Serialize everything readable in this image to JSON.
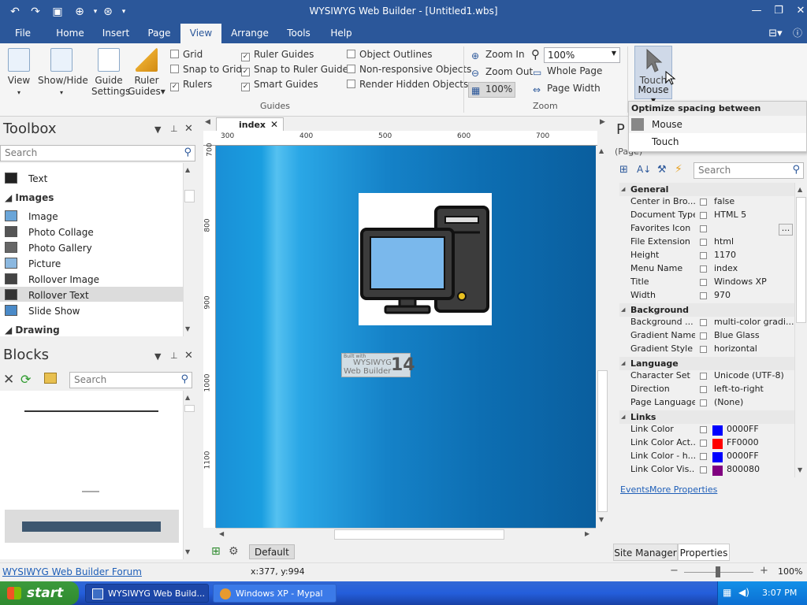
{
  "window": {
    "title": "WYSIWYG Web Builder - [Untitled1.wbs]"
  },
  "menu": {
    "tabs": [
      "File",
      "Home",
      "Insert",
      "Page",
      "View",
      "Arrange",
      "Tools",
      "Help"
    ],
    "active": "View"
  },
  "ribbon": {
    "view_label": "View",
    "showhide_label": "Show/Hide",
    "guide_settings_label": "Guide Settings",
    "ruler_guides_label": "Ruler Guides",
    "guides_checks": [
      {
        "label": "Grid",
        "checked": false
      },
      {
        "label": "Snap to Grid",
        "checked": false
      },
      {
        "label": "Rulers",
        "checked": true
      },
      {
        "label": "Ruler Guides",
        "checked": true
      },
      {
        "label": "Snap to Ruler Guides",
        "checked": true
      },
      {
        "label": "Smart Guides",
        "checked": true
      },
      {
        "label": "Object Outlines",
        "checked": false
      },
      {
        "label": "Non-responsive Objects",
        "checked": false
      },
      {
        "label": "Render Hidden Objects",
        "checked": false
      }
    ],
    "guides_group": "Guides",
    "zoom_in": "Zoom In",
    "zoom_out": "Zoom Out",
    "zoom_100": "100%",
    "zoom_value": "100%",
    "whole_page": "Whole Page",
    "page_width": "Page Width",
    "zoom_group": "Zoom",
    "touch_mouse_top": "Touch",
    "touch_mouse_bottom": "Mouse"
  },
  "dropdown": {
    "header": "Optimize spacing between commands",
    "items": [
      "Mouse",
      "Touch"
    ]
  },
  "toolbox": {
    "title": "Toolbox",
    "search_placeholder": "Search",
    "items": [
      {
        "kind": "item",
        "label": "Text"
      },
      {
        "kind": "cat",
        "label": "Images"
      },
      {
        "kind": "item",
        "label": "Image"
      },
      {
        "kind": "item",
        "label": "Photo Collage"
      },
      {
        "kind": "item",
        "label": "Photo Gallery"
      },
      {
        "kind": "item",
        "label": "Picture"
      },
      {
        "kind": "item",
        "label": "Rollover Image"
      },
      {
        "kind": "item",
        "label": "Rollover Text"
      },
      {
        "kind": "item",
        "label": "Slide Show"
      },
      {
        "kind": "cat",
        "label": "Drawing"
      }
    ],
    "selected": "Rollover Text"
  },
  "blocks": {
    "title": "Blocks",
    "search_placeholder": "Search"
  },
  "document": {
    "tab": "index",
    "ruler_h": [
      "300",
      "400",
      "500",
      "600",
      "700"
    ],
    "ruler_v": [
      "700",
      "800",
      "900",
      "1000",
      "1100"
    ],
    "badge_small": "Built with",
    "badge_line1": "WYSIWYG",
    "badge_line2": "Web Builder",
    "badge_num": "14",
    "layout_tab": "Default"
  },
  "properties": {
    "title_letter": "P",
    "context": "(Page)",
    "search_placeholder": "Search",
    "sections": [
      {
        "name": "General",
        "rows": [
          {
            "name": "Center in Bro...",
            "value": "false"
          },
          {
            "name": "Document Type",
            "value": "HTML 5"
          },
          {
            "name": "Favorites Icon",
            "value": ""
          },
          {
            "name": "File Extension",
            "value": "html"
          },
          {
            "name": "Height",
            "value": "1170"
          },
          {
            "name": "Menu Name",
            "value": "index"
          },
          {
            "name": "Title",
            "value": "Windows XP"
          },
          {
            "name": "Width",
            "value": "970"
          }
        ]
      },
      {
        "name": "Background",
        "rows": [
          {
            "name": "Background ...",
            "value": "multi-color gradi..."
          },
          {
            "name": "Gradient Name",
            "value": "Blue Glass"
          },
          {
            "name": "Gradient Style",
            "value": "horizontal"
          }
        ]
      },
      {
        "name": "Language",
        "rows": [
          {
            "name": "Character Set",
            "value": "Unicode (UTF-8)"
          },
          {
            "name": "Direction",
            "value": "left-to-right"
          },
          {
            "name": "Page Language",
            "value": "(None)"
          }
        ]
      },
      {
        "name": "Links",
        "rows": [
          {
            "name": "Link Color",
            "value": "0000FF",
            "swatch": "#0000FF"
          },
          {
            "name": "Link Color Act...",
            "value": "FF0000",
            "swatch": "#FF0000"
          },
          {
            "name": "Link Color - h...",
            "value": "0000FF",
            "swatch": "#0000FF"
          },
          {
            "name": "Link Color Vis...",
            "value": "800080",
            "swatch": "#800080"
          }
        ]
      }
    ],
    "events_link": "Events",
    "more_link": "More Properties",
    "tab_site": "Site Manager",
    "tab_props": "Properties"
  },
  "status": {
    "forum_link": "WYSIWYG Web Builder Forum",
    "coords": "x:377, y:994",
    "zoom": "100%"
  },
  "taskbar": {
    "start": "start",
    "tasks": [
      "WYSIWYG Web Build...",
      "Windows XP - Mypal"
    ],
    "clock": "3:07 PM"
  }
}
